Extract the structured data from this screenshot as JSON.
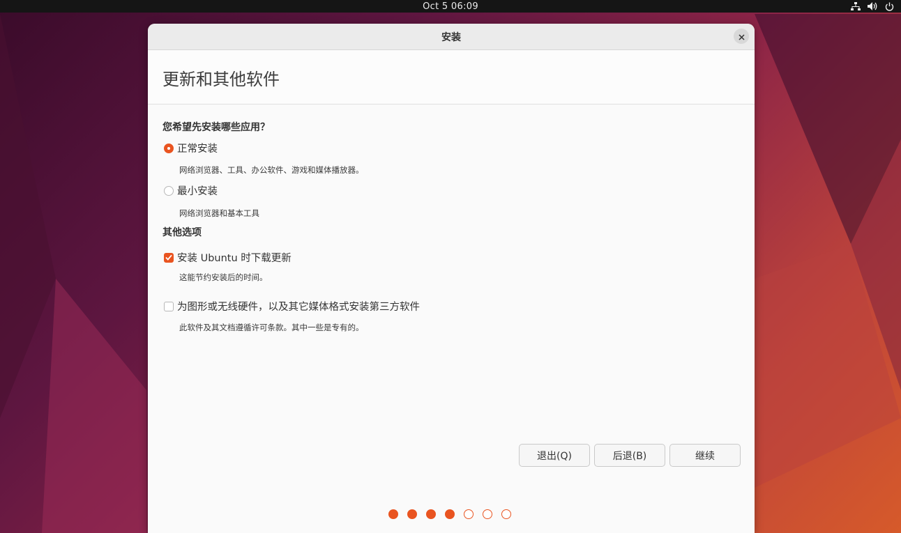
{
  "topbar": {
    "clock": "Oct 5  06:09"
  },
  "tray": {
    "network_icon": "network-wired-icon",
    "volume_icon": "volume-icon",
    "power_icon": "power-icon"
  },
  "window": {
    "title": "安装",
    "close_icon": "close-icon"
  },
  "page": {
    "heading": "更新和其他软件"
  },
  "install_type": {
    "question": "您希望先安装哪些应用？",
    "options": [
      {
        "label": "正常安装",
        "description": "网络浏览器、工具、办公软件、游戏和媒体播放器。",
        "selected": true
      },
      {
        "label": "最小安装",
        "description": "网络浏览器和基本工具",
        "selected": false
      }
    ]
  },
  "other_options": {
    "title": "其他选项",
    "items": [
      {
        "label": "安装 Ubuntu 时下载更新",
        "description": "这能节约安装后的时间。",
        "checked": true
      },
      {
        "label": "为图形或无线硬件，以及其它媒体格式安装第三方软件",
        "description": "此软件及其文档遵循许可条款。其中一些是专有的。",
        "checked": false
      }
    ]
  },
  "buttons": {
    "quit": "退出(Q)",
    "back": "后退(B)",
    "continue": "继续"
  },
  "progress": {
    "total_steps": 7,
    "completed_steps": 4
  },
  "colors": {
    "accent": "#e95420",
    "topbar": "#151515"
  }
}
